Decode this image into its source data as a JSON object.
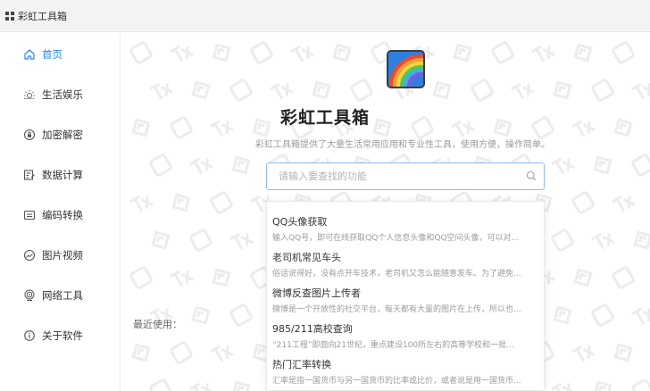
{
  "window": {
    "title": "彩虹工具箱"
  },
  "sidebar": {
    "items": [
      {
        "label": "首页",
        "icon": "home-icon",
        "active": true
      },
      {
        "label": "生活娱乐",
        "icon": "sun-icon"
      },
      {
        "label": "加密解密",
        "icon": "lock-circle-icon"
      },
      {
        "label": "数据计算",
        "icon": "calculator-icon"
      },
      {
        "label": "编码转换",
        "icon": "code-box-icon"
      },
      {
        "label": "图片视频",
        "icon": "image-icon"
      },
      {
        "label": "网络工具",
        "icon": "network-icon"
      },
      {
        "label": "关于软件",
        "icon": "info-icon"
      }
    ]
  },
  "main": {
    "logo_icon": "rainbow-logo-icon",
    "title": "彩虹工具箱",
    "description": "彩虹工具箱提供了大量生活常用应用和专业性工具，使用方便，操作简单。",
    "search": {
      "placeholder": "请输入要查找的功能",
      "value": ""
    },
    "results": [
      {
        "title": "QQ头像获取",
        "desc": "输入QQ号，即可在线获取QQ个人信息头像和QQ空间头像，可以对..."
      },
      {
        "title": "老司机常见车头",
        "desc": "俗话说得好，没有点开车技术，老司机又怎么能随意发车。为了避免..."
      },
      {
        "title": "微博反查图片上传者",
        "desc": "微博是一个开放性的社交平台，每天都有大量的图片在上传，所以也..."
      },
      {
        "title": "985/211高校查询",
        "desc": "“211工程”即面向21世纪，重点建设100所左右的高等学校和一批..."
      },
      {
        "title": "热门汇率转换",
        "desc": "汇率是指一国货币与另一国货币的比率或比价，或者说是用一国货币..."
      }
    ],
    "recent_label": "最近使用："
  },
  "colors": {
    "accent": "#2b86f0",
    "watermark": "#ececec"
  }
}
